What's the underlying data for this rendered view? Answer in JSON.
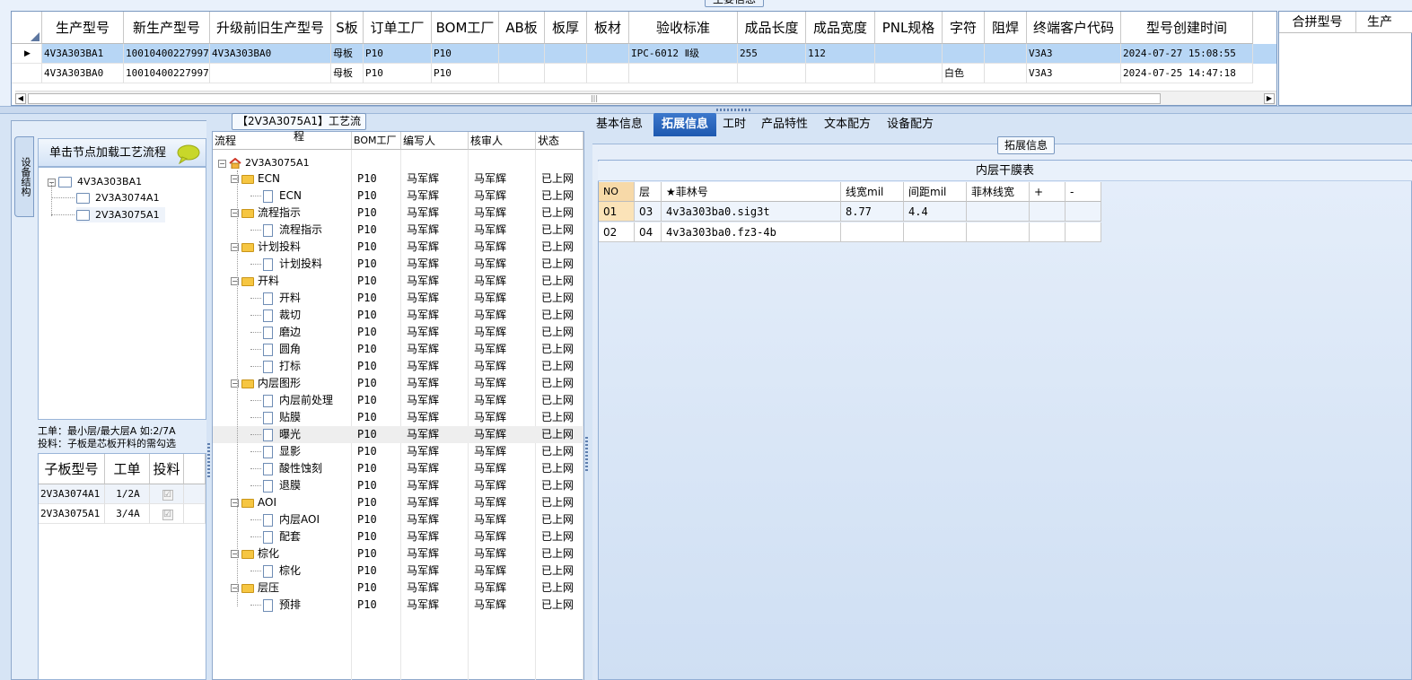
{
  "top_section": {
    "title": "主要信息",
    "columns": [
      "生产型号",
      "新生产型号",
      "升级前旧生产型号",
      "S板",
      "订单工厂",
      "BOM工厂",
      "AB板",
      "板厚",
      "板材",
      "验收标准",
      "成品长度",
      "成品宽度",
      "PNL规格",
      "字符",
      "阻焊",
      "终端客户代码",
      "型号创建时间"
    ],
    "rows": [
      {
        "cells": [
          "4V3A303BA1",
          "10010400227997",
          "4V3A303BA0",
          "母板",
          "P10",
          "P10",
          "",
          "",
          "",
          "IPC-6012 Ⅱ级",
          "255",
          "112",
          "",
          "",
          "",
          "V3A3",
          "2024-07-27 15:08:55"
        ],
        "selected": true
      },
      {
        "cells": [
          "4V3A303BA0",
          "10010400227997",
          "",
          "母板",
          "P10",
          "P10",
          "",
          "",
          "",
          "",
          "",
          "",
          "",
          "白色",
          "",
          "V3A3",
          "2024-07-25 14:47:18"
        ],
        "selected": false
      }
    ],
    "merge_columns": [
      "合拼型号",
      "生产"
    ]
  },
  "left_panel": {
    "vertical_tab": "设备结构",
    "header": "单击节点加载工艺流程",
    "tree": [
      {
        "label": "4V3A303BA1",
        "level": 0,
        "expander": "⊟"
      },
      {
        "label": "2V3A3074A1",
        "level": 1
      },
      {
        "label": "2V3A3075A1",
        "level": 1
      }
    ],
    "note_line1": "工单：最小层/最大层A 如:2/7A",
    "note_line2": "投料：子板是芯板开料的需勾选",
    "sub_columns": [
      "子板型号",
      "工单",
      "投料"
    ],
    "sub_rows": [
      {
        "model": "2V3A3074A1",
        "order": "1/2A",
        "feed": "☑"
      },
      {
        "model": "2V3A3075A1",
        "order": "3/4A",
        "feed": "☑"
      }
    ]
  },
  "process_panel": {
    "title": "【2V3A3075A1】工艺流程",
    "columns": [
      "流程",
      "BOM工厂",
      "编写人",
      "核审人",
      "状态"
    ],
    "root": "2V3A3075A1",
    "rows": [
      {
        "name": "ECN",
        "type": "folder",
        "factory": "P10",
        "writer": "马军辉",
        "reviewer": "马军辉",
        "status": "已上网"
      },
      {
        "name": "ECN",
        "type": "doc",
        "factory": "P10",
        "writer": "马军辉",
        "reviewer": "马军辉",
        "status": "已上网"
      },
      {
        "name": "流程指示",
        "type": "folder",
        "factory": "P10",
        "writer": "马军辉",
        "reviewer": "马军辉",
        "status": "已上网"
      },
      {
        "name": "流程指示",
        "type": "doc",
        "factory": "P10",
        "writer": "马军辉",
        "reviewer": "马军辉",
        "status": "已上网"
      },
      {
        "name": "计划投料",
        "type": "folder",
        "factory": "P10",
        "writer": "马军辉",
        "reviewer": "马军辉",
        "status": "已上网"
      },
      {
        "name": "计划投料",
        "type": "doc",
        "factory": "P10",
        "writer": "马军辉",
        "reviewer": "马军辉",
        "status": "已上网"
      },
      {
        "name": "开料",
        "type": "folder",
        "factory": "P10",
        "writer": "马军辉",
        "reviewer": "马军辉",
        "status": "已上网"
      },
      {
        "name": "开料",
        "type": "doc",
        "factory": "P10",
        "writer": "马军辉",
        "reviewer": "马军辉",
        "status": "已上网"
      },
      {
        "name": "裁切",
        "type": "doc",
        "factory": "P10",
        "writer": "马军辉",
        "reviewer": "马军辉",
        "status": "已上网"
      },
      {
        "name": "磨边",
        "type": "doc",
        "factory": "P10",
        "writer": "马军辉",
        "reviewer": "马军辉",
        "status": "已上网"
      },
      {
        "name": "圆角",
        "type": "doc",
        "factory": "P10",
        "writer": "马军辉",
        "reviewer": "马军辉",
        "status": "已上网"
      },
      {
        "name": "打标",
        "type": "doc",
        "factory": "P10",
        "writer": "马军辉",
        "reviewer": "马军辉",
        "status": "已上网"
      },
      {
        "name": "内层图形",
        "type": "folder",
        "factory": "P10",
        "writer": "马军辉",
        "reviewer": "马军辉",
        "status": "已上网"
      },
      {
        "name": "内层前处理",
        "type": "doc",
        "factory": "P10",
        "writer": "马军辉",
        "reviewer": "马军辉",
        "status": "已上网"
      },
      {
        "name": "贴膜",
        "type": "doc",
        "factory": "P10",
        "writer": "马军辉",
        "reviewer": "马军辉",
        "status": "已上网"
      },
      {
        "name": "曝光",
        "type": "doc",
        "factory": "P10",
        "writer": "马军辉",
        "reviewer": "马军辉",
        "status": "已上网",
        "selected": true
      },
      {
        "name": "显影",
        "type": "doc",
        "factory": "P10",
        "writer": "马军辉",
        "reviewer": "马军辉",
        "status": "已上网"
      },
      {
        "name": "酸性蚀刻",
        "type": "doc",
        "factory": "P10",
        "writer": "马军辉",
        "reviewer": "马军辉",
        "status": "已上网"
      },
      {
        "name": "退膜",
        "type": "doc",
        "factory": "P10",
        "writer": "马军辉",
        "reviewer": "马军辉",
        "status": "已上网"
      },
      {
        "name": "AOI",
        "type": "folder",
        "factory": "P10",
        "writer": "马军辉",
        "reviewer": "马军辉",
        "status": "已上网"
      },
      {
        "name": "内层AOI",
        "type": "doc",
        "factory": "P10",
        "writer": "马军辉",
        "reviewer": "马军辉",
        "status": "已上网"
      },
      {
        "name": "配套",
        "type": "doc",
        "factory": "P10",
        "writer": "马军辉",
        "reviewer": "马军辉",
        "status": "已上网"
      },
      {
        "name": "棕化",
        "type": "folder",
        "factory": "P10",
        "writer": "马军辉",
        "reviewer": "马军辉",
        "status": "已上网"
      },
      {
        "name": "棕化",
        "type": "doc",
        "factory": "P10",
        "writer": "马军辉",
        "reviewer": "马军辉",
        "status": "已上网"
      },
      {
        "name": "层压",
        "type": "folder",
        "factory": "P10",
        "writer": "马军辉",
        "reviewer": "马军辉",
        "status": "已上网"
      },
      {
        "name": "预排",
        "type": "doc",
        "factory": "P10",
        "writer": "马军辉",
        "reviewer": "马军辉",
        "status": "已上网"
      }
    ]
  },
  "right_panel": {
    "tabs": [
      "基本信息",
      "拓展信息",
      "工时",
      "产品特性",
      "文本配方",
      "设备配方"
    ],
    "active_tab": "拓展信息",
    "section_title": "拓展信息",
    "table_caption": "内层干膜表",
    "columns": [
      "NO",
      "层",
      "★菲林号",
      "线宽mil",
      "间距mil",
      "菲林线宽",
      "+",
      "-"
    ],
    "rows": [
      [
        "01",
        "03",
        "4v3a303ba0.sig3t",
        "8.77",
        "4.4",
        "",
        "",
        ""
      ],
      [
        "02",
        "04",
        "4v3a303ba0.fz3-4b",
        "",
        "",
        "",
        "",
        ""
      ]
    ]
  },
  "colors": {
    "selected_row": "#b7d6f5",
    "active_tab": "#1f5bb3",
    "panel_bg": "#d6e4f5"
  }
}
